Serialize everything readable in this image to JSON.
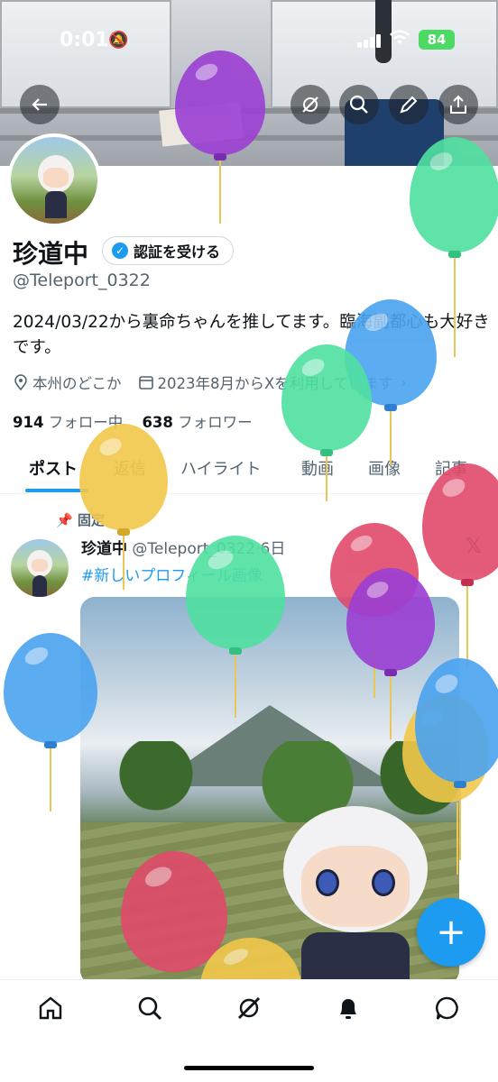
{
  "status_bar": {
    "time": "0:01",
    "battery": "84"
  },
  "profile": {
    "display_name": "珍道中",
    "verify_label": "認証を受ける",
    "handle": "@Teleport_0322",
    "bio": "2024/03/22から裏命ちゃんを推してます。臨海副都心も大好きです。",
    "location": "本州のどこか",
    "joined": "2023年8月からXを利用しています",
    "following_count": "914",
    "following_label": "フォロー中",
    "followers_count": "638",
    "followers_label": "フォロワー"
  },
  "tabs": [
    {
      "label": "ポスト"
    },
    {
      "label": "返信"
    },
    {
      "label": "ハイライト"
    },
    {
      "label": "動画"
    },
    {
      "label": "画像"
    },
    {
      "label": "記事"
    }
  ],
  "post": {
    "pinned_label": "固定",
    "author": "珍道中",
    "handle_time": "@Teleport_0322·6日",
    "text": "#新しいプロフィール画像",
    "source_mark": "𝕏"
  },
  "colors": {
    "accent": "#1d9bf0",
    "balloon_purple": "#9b3fd4",
    "balloon_green": "#4fe0a0",
    "balloon_blue": "#4aa3f0",
    "balloon_yellow": "#f2c84b",
    "balloon_red": "#e04a6a"
  },
  "icons": {
    "back": "back-arrow-icon",
    "grok": "grok-icon",
    "search": "search-icon",
    "edit": "edit-icon",
    "share": "share-icon",
    "location": "location-icon",
    "calendar": "calendar-icon",
    "pin": "pin-icon",
    "compose": "plus-icon",
    "nav_home": "home-icon",
    "nav_search": "search-icon",
    "nav_grok": "grok-icon",
    "nav_notifications": "bell-icon",
    "nav_messages": "chat-icon"
  }
}
